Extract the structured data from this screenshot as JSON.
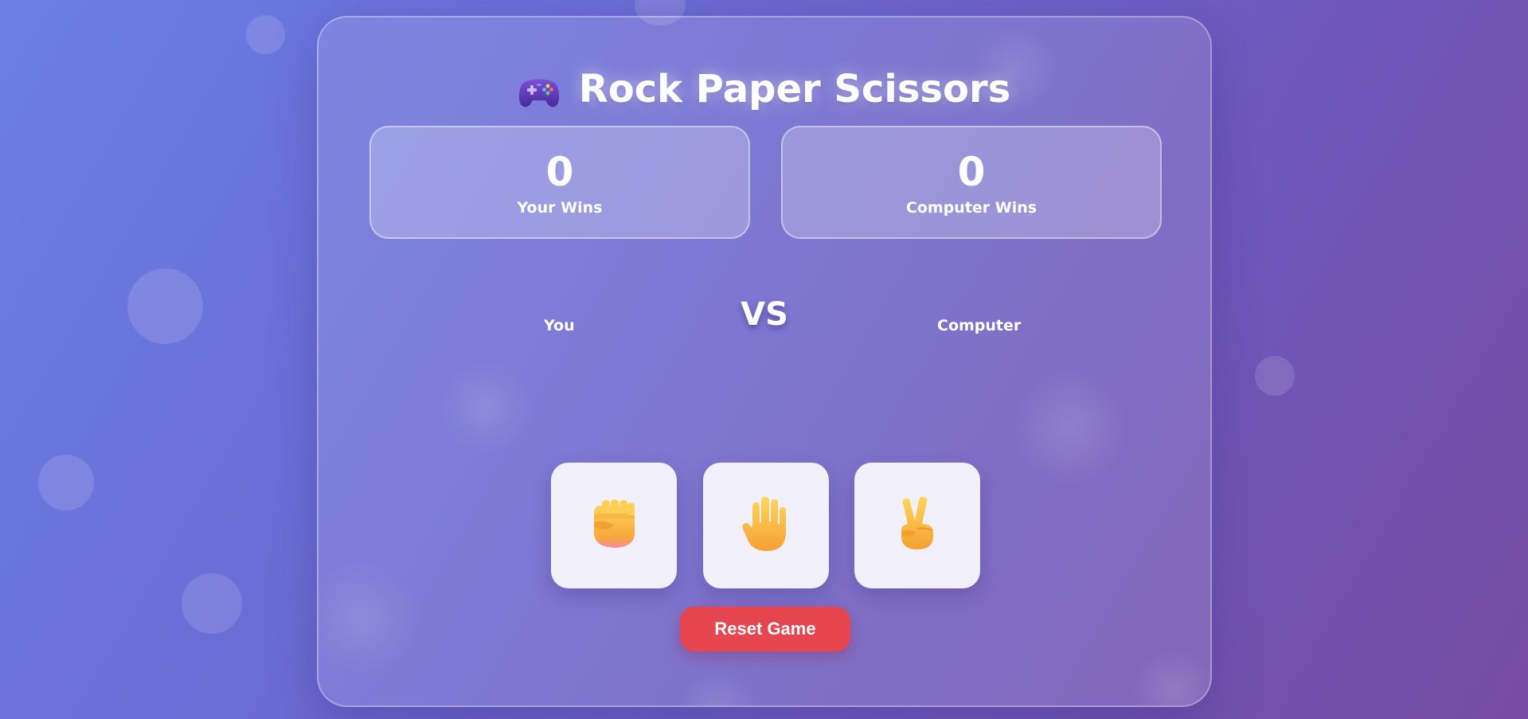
{
  "app": {
    "title": "Rock Paper Scissors",
    "title_icon": "game-controller-icon"
  },
  "scores": {
    "player": {
      "value": "0",
      "label": "Your Wins"
    },
    "computer": {
      "value": "0",
      "label": "Computer Wins"
    }
  },
  "battle": {
    "player_label": "You",
    "vs_label": "VS",
    "computer_label": "Computer"
  },
  "choices": [
    {
      "name": "rock",
      "icon": "fist-icon"
    },
    {
      "name": "paper",
      "icon": "raised-hand-icon"
    },
    {
      "name": "scissors",
      "icon": "victory-hand-icon"
    }
  ],
  "controls": {
    "reset_label": "Reset Game",
    "reset_color": "#e5464f"
  },
  "colors": {
    "background_start": "#6a7fe6",
    "background_end": "#764ba2",
    "card_button": "#f2f0fa",
    "hand": "#f7b73a"
  }
}
